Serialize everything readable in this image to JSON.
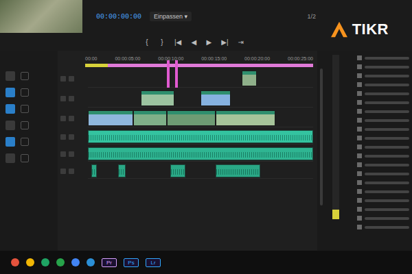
{
  "logo": {
    "text": "TIKR"
  },
  "program": {
    "timecode": "00:00:00:00",
    "fit": "Einpassen",
    "fit_arrow": "▾",
    "ratio": "1/2"
  },
  "transport": [
    "{",
    "}",
    "|◀",
    "◀",
    "▶",
    "▶|",
    "⇥"
  ],
  "tools": [
    {
      "selected": false
    },
    {
      "selected": true
    },
    {
      "selected": true
    },
    {
      "selected": false
    },
    {
      "selected": true
    },
    {
      "selected": false
    }
  ],
  "ruler": [
    "00:00",
    "00:00:05:00",
    "00:00:10:00",
    "00:00:15:00",
    "00:00:20:00",
    "00:00:25:00"
  ],
  "work_area": {
    "start": 3,
    "end": 30
  },
  "markers": [
    {
      "time": 10.5
    },
    {
      "time": 11.6
    }
  ],
  "tracks": [
    {
      "kind": "video",
      "clips": [
        {
          "start": 20.5,
          "end": 22.5,
          "color": "#8fb08a"
        }
      ]
    },
    {
      "kind": "video",
      "clips": [
        {
          "start": 7,
          "end": 11.5,
          "color": "#9cc3a0"
        },
        {
          "start": 15,
          "end": 19,
          "color": "#86b2e0"
        }
      ]
    },
    {
      "kind": "video",
      "clips": [
        {
          "start": 0,
          "end": 6,
          "color": "#8fb7dd"
        },
        {
          "start": 6,
          "end": 10.5,
          "color": "#7fb089"
        },
        {
          "start": 10.5,
          "end": 17,
          "color": "#6e9c74"
        },
        {
          "start": 17,
          "end": 25,
          "color": "#a6c49a"
        }
      ]
    },
    {
      "kind": "audio",
      "clips": [
        {
          "start": 0,
          "end": 30,
          "color": "#34c3a0"
        }
      ]
    },
    {
      "kind": "audio",
      "clips": [
        {
          "start": 0,
          "end": 30,
          "color": "#2fb592"
        }
      ]
    },
    {
      "kind": "audio",
      "clips": [
        {
          "start": 0.5,
          "end": 1.2,
          "color": "#2aa886"
        },
        {
          "start": 4,
          "end": 5,
          "color": "#2aa886"
        },
        {
          "start": 11,
          "end": 13,
          "color": "#2aa886"
        },
        {
          "start": 17,
          "end": 23,
          "color": "#2aa886"
        }
      ]
    }
  ],
  "meter": {
    "level": 0.06
  },
  "taskbar": [
    {
      "kind": "dot",
      "label": "",
      "color": "#e5533d"
    },
    {
      "kind": "dot",
      "label": "",
      "color": "#f2b705"
    },
    {
      "kind": "dot",
      "label": "",
      "color": "#1fa463"
    },
    {
      "kind": "dot",
      "label": "",
      "color": "#27a34a"
    },
    {
      "kind": "dot",
      "label": "",
      "color": "#4285f4"
    },
    {
      "kind": "dot",
      "label": "",
      "color": "#2b8fd6"
    },
    {
      "kind": "app",
      "label": "Pr",
      "color": "#d8a1ff"
    },
    {
      "kind": "app",
      "label": "Ps",
      "color": "#31a8ff"
    },
    {
      "kind": "app",
      "label": "Lr",
      "color": "#31a8ff"
    }
  ]
}
